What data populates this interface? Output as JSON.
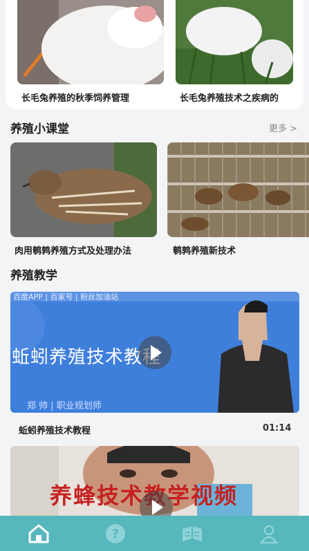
{
  "top_articles": [
    {
      "title": "长毛兔养殖的秋季饲养管理"
    },
    {
      "title": "长毛兔养殖技术之疾病的"
    }
  ],
  "classroom": {
    "title": "养殖小课堂",
    "more": "更多 >",
    "items": [
      {
        "title": "肉用鹌鹑养殖方式及处理办法"
      },
      {
        "title": "鹌鹑养殖新技术"
      }
    ]
  },
  "teaching": {
    "title": "养殖教学",
    "videos": [
      {
        "title": "蚯蚓养殖技术教程",
        "duration": "01:14",
        "banner_text": "蚯蚓养殖技术教程",
        "header_text": "百度APP | 百家号 | 粉丝加油站",
        "lower_text": "郑 帅 | 职业规划师"
      },
      {
        "banner_text": "养蜂技术教学视频"
      }
    ]
  },
  "tabbar": {
    "active_color": "#ffffff",
    "inactive_color": "#8ed3d7",
    "items": [
      {
        "icon": "home-icon"
      },
      {
        "icon": "question-icon"
      },
      {
        "icon": "book-icon"
      },
      {
        "icon": "user-icon"
      }
    ]
  }
}
